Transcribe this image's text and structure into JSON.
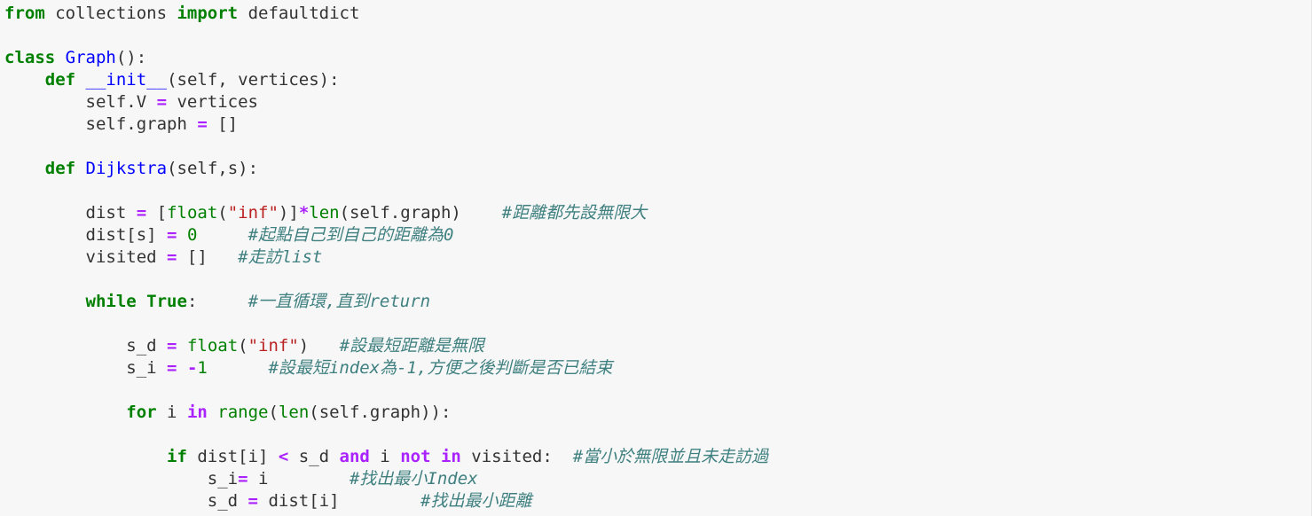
{
  "editor": {
    "lines": [
      [
        {
          "t": "from",
          "c": "kw"
        },
        {
          "t": " collections ",
          "c": ""
        },
        {
          "t": "import",
          "c": "kw"
        },
        {
          "t": " defaultdict",
          "c": ""
        }
      ],
      [],
      [
        {
          "t": "class",
          "c": "kw"
        },
        {
          "t": " ",
          "c": ""
        },
        {
          "t": "Graph",
          "c": "def"
        },
        {
          "t": "():",
          "c": ""
        }
      ],
      [
        {
          "t": "    ",
          "c": ""
        },
        {
          "t": "def",
          "c": "kw"
        },
        {
          "t": " ",
          "c": ""
        },
        {
          "t": "__init__",
          "c": "def"
        },
        {
          "t": "(self, vertices):",
          "c": ""
        }
      ],
      [
        {
          "t": "        self.V ",
          "c": ""
        },
        {
          "t": "=",
          "c": "op"
        },
        {
          "t": " vertices",
          "c": ""
        }
      ],
      [
        {
          "t": "        self.graph ",
          "c": ""
        },
        {
          "t": "=",
          "c": "op"
        },
        {
          "t": " []",
          "c": ""
        }
      ],
      [],
      [
        {
          "t": "    ",
          "c": ""
        },
        {
          "t": "def",
          "c": "kw"
        },
        {
          "t": " ",
          "c": ""
        },
        {
          "t": "Dijkstra",
          "c": "def"
        },
        {
          "t": "(self,s):",
          "c": ""
        }
      ],
      [],
      [
        {
          "t": "        dist ",
          "c": ""
        },
        {
          "t": "=",
          "c": "op"
        },
        {
          "t": " [",
          "c": ""
        },
        {
          "t": "float",
          "c": "bi"
        },
        {
          "t": "(",
          "c": ""
        },
        {
          "t": "\"inf\"",
          "c": "str"
        },
        {
          "t": ")]",
          "c": ""
        },
        {
          "t": "*",
          "c": "op"
        },
        {
          "t": "len",
          "c": "bi"
        },
        {
          "t": "(self.graph)    ",
          "c": ""
        },
        {
          "t": "#距離都先設無限大",
          "c": "cm"
        }
      ],
      [
        {
          "t": "        dist[s] ",
          "c": ""
        },
        {
          "t": "=",
          "c": "op"
        },
        {
          "t": " ",
          "c": ""
        },
        {
          "t": "0",
          "c": "num"
        },
        {
          "t": "     ",
          "c": ""
        },
        {
          "t": "#起點自己到自己的距離為0",
          "c": "cm"
        }
      ],
      [
        {
          "t": "        visited ",
          "c": ""
        },
        {
          "t": "=",
          "c": "op"
        },
        {
          "t": " []   ",
          "c": ""
        },
        {
          "t": "#走訪list",
          "c": "cm"
        }
      ],
      [],
      [
        {
          "t": "        ",
          "c": ""
        },
        {
          "t": "while",
          "c": "kw"
        },
        {
          "t": " ",
          "c": ""
        },
        {
          "t": "True",
          "c": "kw"
        },
        {
          "t": ":     ",
          "c": ""
        },
        {
          "t": "#一直循環,直到return",
          "c": "cm"
        }
      ],
      [],
      [
        {
          "t": "            s_d ",
          "c": ""
        },
        {
          "t": "=",
          "c": "op"
        },
        {
          "t": " ",
          "c": ""
        },
        {
          "t": "float",
          "c": "bi"
        },
        {
          "t": "(",
          "c": ""
        },
        {
          "t": "\"inf\"",
          "c": "str"
        },
        {
          "t": ")   ",
          "c": ""
        },
        {
          "t": "#設最短距離是無限",
          "c": "cm"
        }
      ],
      [
        {
          "t": "            s_i ",
          "c": ""
        },
        {
          "t": "=",
          "c": "op"
        },
        {
          "t": " ",
          "c": ""
        },
        {
          "t": "-",
          "c": "op"
        },
        {
          "t": "1",
          "c": "num"
        },
        {
          "t": "      ",
          "c": ""
        },
        {
          "t": "#設最短index為-1,方便之後判斷是否已結束",
          "c": "cm"
        }
      ],
      [],
      [
        {
          "t": "            ",
          "c": ""
        },
        {
          "t": "for",
          "c": "kw"
        },
        {
          "t": " i ",
          "c": ""
        },
        {
          "t": "in",
          "c": "op"
        },
        {
          "t": " ",
          "c": ""
        },
        {
          "t": "range",
          "c": "bi"
        },
        {
          "t": "(",
          "c": ""
        },
        {
          "t": "len",
          "c": "bi"
        },
        {
          "t": "(self.graph)):",
          "c": ""
        }
      ],
      [],
      [
        {
          "t": "                ",
          "c": ""
        },
        {
          "t": "if",
          "c": "kw"
        },
        {
          "t": " dist[i] ",
          "c": ""
        },
        {
          "t": "<",
          "c": "op"
        },
        {
          "t": " s_d ",
          "c": ""
        },
        {
          "t": "and",
          "c": "op"
        },
        {
          "t": " i ",
          "c": ""
        },
        {
          "t": "not",
          "c": "op"
        },
        {
          "t": " ",
          "c": ""
        },
        {
          "t": "in",
          "c": "op"
        },
        {
          "t": " visited:  ",
          "c": ""
        },
        {
          "t": "#當小於無限並且未走訪過",
          "c": "cm"
        }
      ],
      [
        {
          "t": "                    s_i",
          "c": ""
        },
        {
          "t": "=",
          "c": "op"
        },
        {
          "t": " i        ",
          "c": ""
        },
        {
          "t": "#找出最小Index",
          "c": "cm"
        }
      ],
      [
        {
          "t": "                    s_d ",
          "c": ""
        },
        {
          "t": "=",
          "c": "op"
        },
        {
          "t": " dist[i]        ",
          "c": ""
        },
        {
          "t": "#找出最小距離",
          "c": "cm"
        }
      ]
    ]
  }
}
